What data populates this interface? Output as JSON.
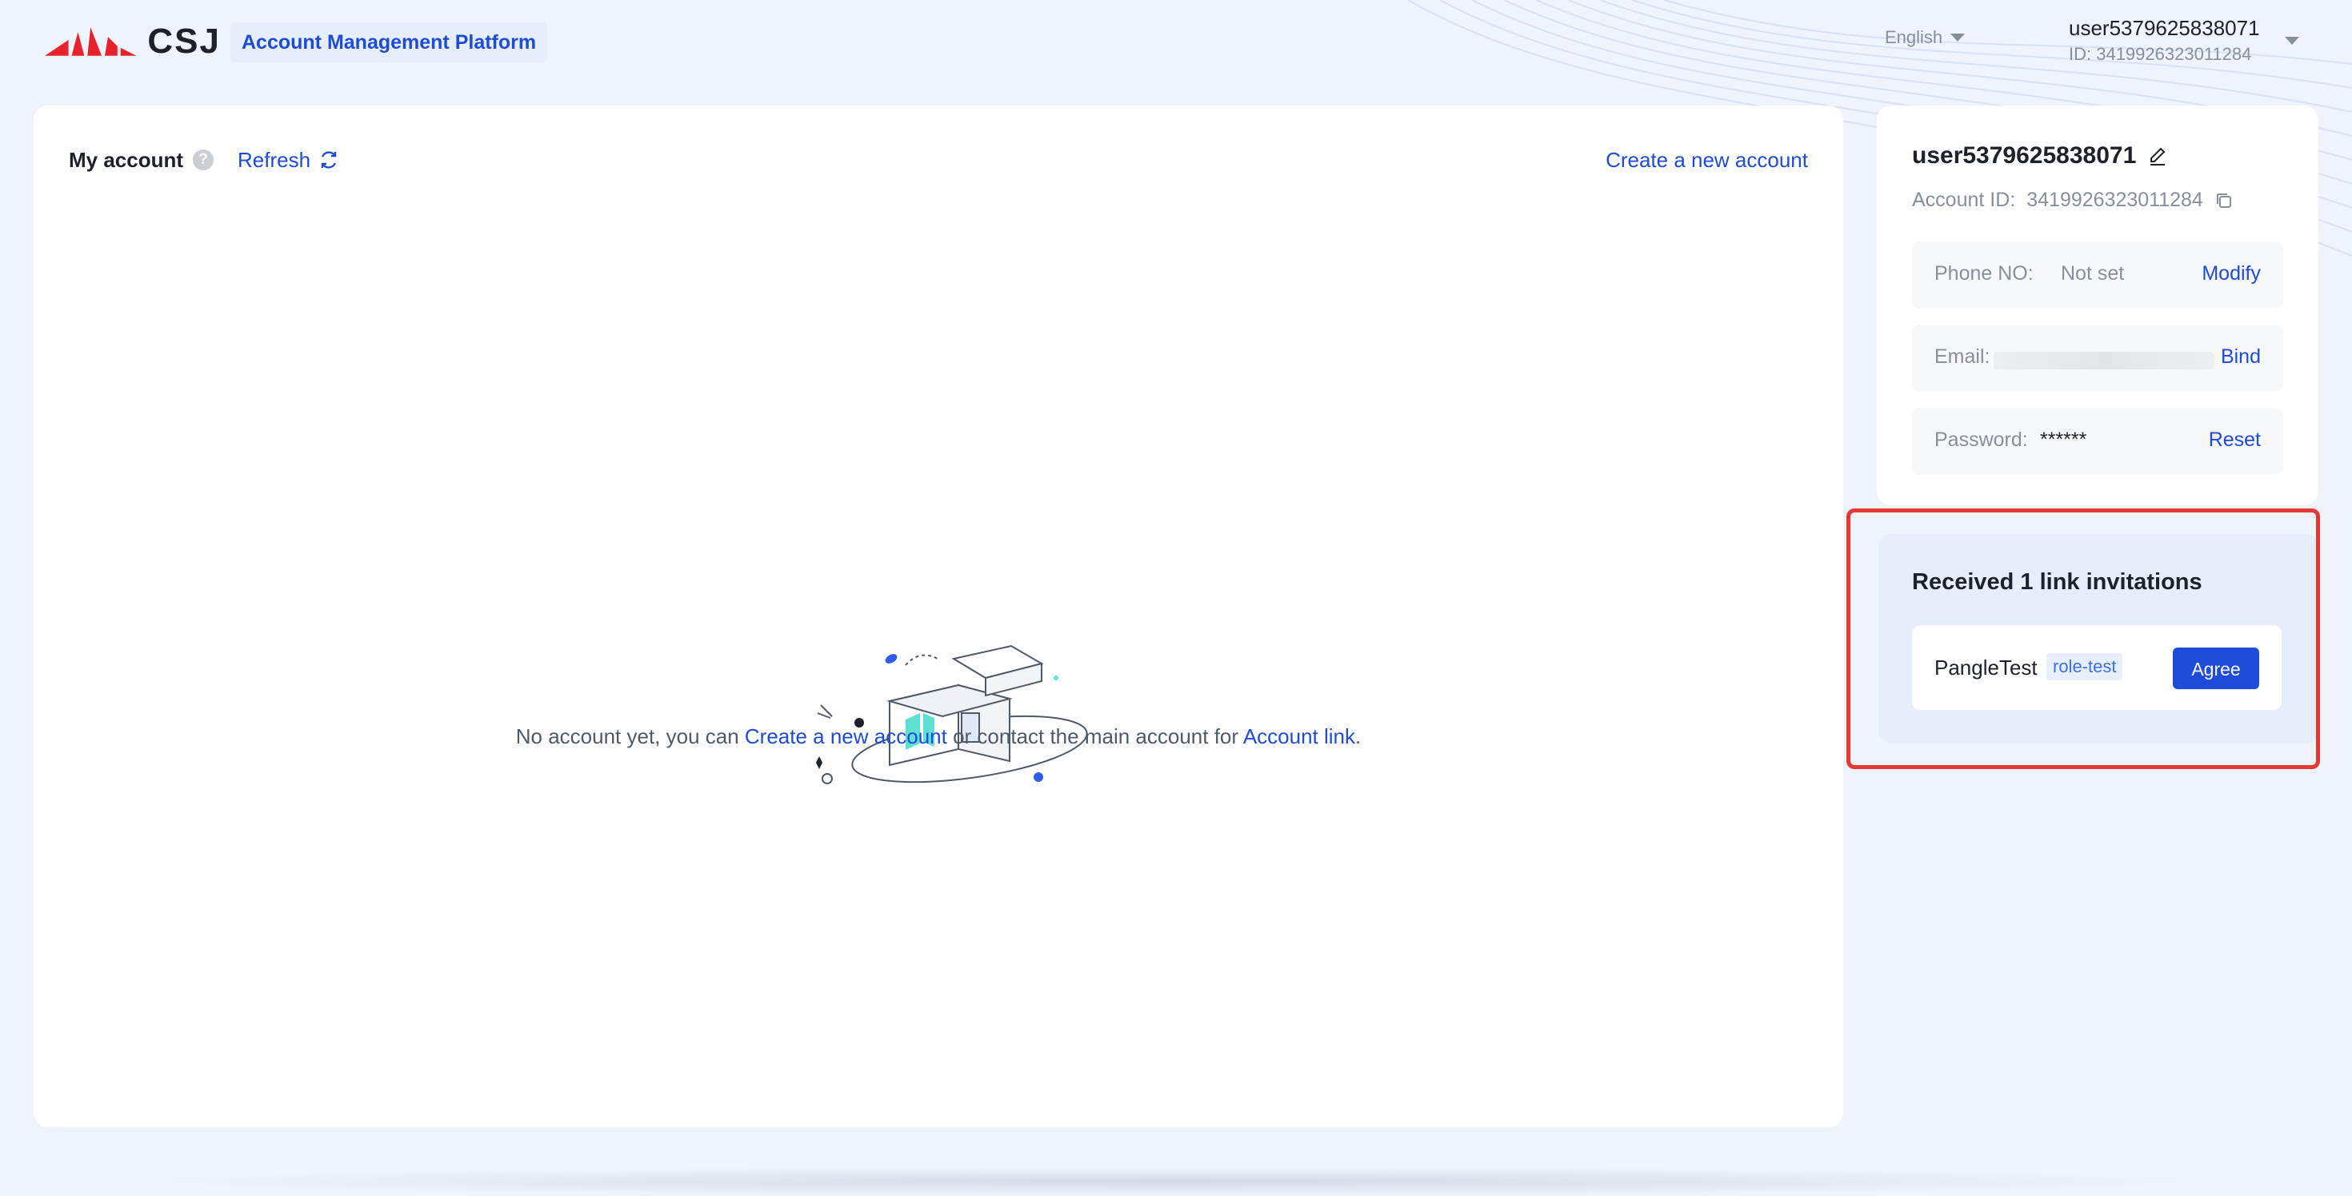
{
  "header": {
    "logo_text": "CSJ",
    "platform_title": "Account Management Platform",
    "language": "English",
    "username": "user5379625838071",
    "user_id": "ID: 3419926323011284"
  },
  "main": {
    "title": "My account",
    "refresh_label": "Refresh",
    "create_link": "Create a new account",
    "empty": {
      "prefix": "No account yet, you can ",
      "create_link": "Create a new account",
      "middle": " or contact the main account for ",
      "link_link": "Account link",
      "suffix": "."
    }
  },
  "profile": {
    "name": "user5379625838071",
    "account_id_label": "Account ID:",
    "account_id": "3419926323011284",
    "phone_label": "Phone NO:",
    "phone_value": "Not set",
    "phone_action": "Modify",
    "email_label": "Email:",
    "email_action": "Bind",
    "password_label": "Password:",
    "password_value": "******",
    "password_action": "Reset"
  },
  "invitations": {
    "title": "Received 1 link invitations",
    "items": [
      {
        "name": "PangleTest",
        "role": "role-test",
        "action": "Agree"
      }
    ]
  },
  "colors": {
    "accent": "#1e4bd8",
    "highlight_border": "#e53935",
    "logo_red": "#e8222a"
  }
}
